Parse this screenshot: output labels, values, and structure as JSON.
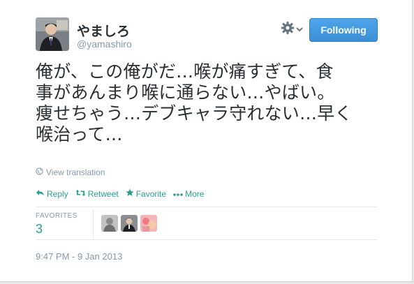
{
  "author": {
    "fullname": "やましろ",
    "username": "@yamashiro"
  },
  "follow_button": {
    "label": "Following"
  },
  "tweet": {
    "lines": [
      "俺が、この俺がだ…喉が痛すぎて、食",
      "事があんまり喉に通らない…やばい。",
      "痩せちゃう…デブキャラ守れない…早く",
      "喉治って…"
    ]
  },
  "translate_label": "View translation",
  "actions": {
    "reply": "Reply",
    "retweet": "Retweet",
    "favorite": "Favorite",
    "more": "More"
  },
  "stats": {
    "favorites_label": "FAVORITES",
    "favorites_count": "3"
  },
  "timestamp": "9:47 PM - 9 Jan 2013",
  "colors": {
    "accent": "#2a9e8c",
    "follow_button": "#3b8fd6",
    "muted": "#8899a6",
    "text": "#292f33"
  },
  "icons": [
    "globe-icon",
    "reply-icon",
    "retweet-icon",
    "star-icon",
    "more-dots-icon",
    "gear-icon",
    "chevron-down-icon"
  ]
}
